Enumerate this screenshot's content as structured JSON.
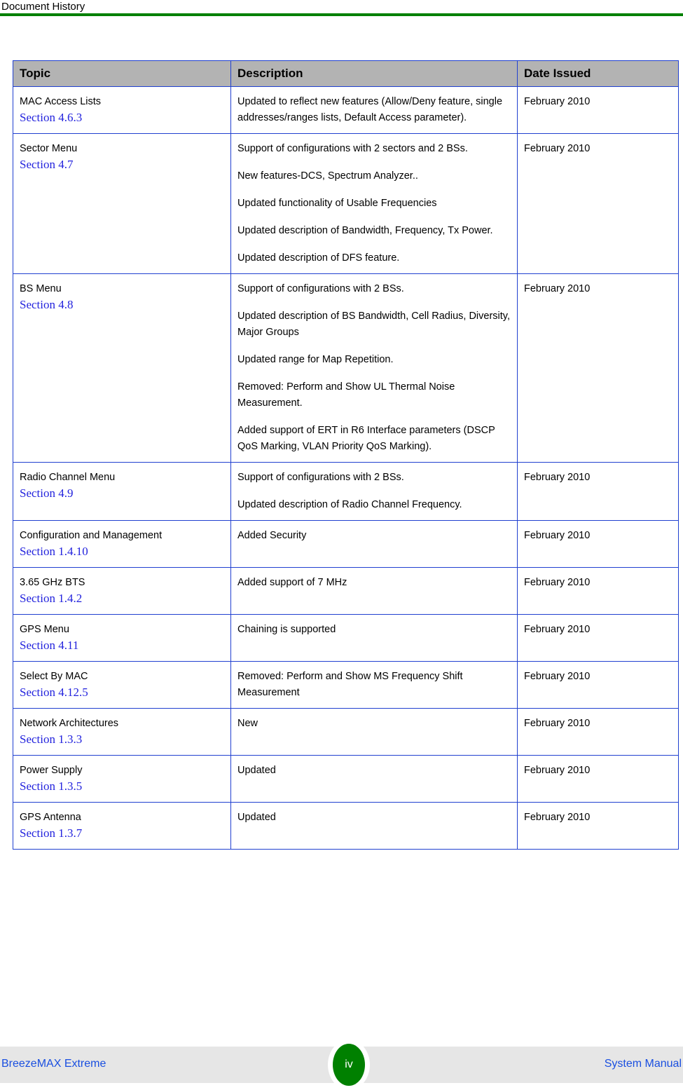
{
  "header": {
    "running_title": "Document History",
    "rule_color": "#008000"
  },
  "table": {
    "columns": [
      "Topic",
      "Description",
      "Date Issued"
    ],
    "header_bg": "#b3b3b3",
    "border_color": "#2040d0",
    "link_color": "#2222dd",
    "rows": [
      {
        "topic": "MAC Access Lists",
        "section": "Section 4.6.3",
        "description": [
          "Updated to reflect new features (Allow/Deny feature, single addresses/ranges lists, Default Access parameter)."
        ],
        "date": "February 2010"
      },
      {
        "topic": "Sector Menu",
        "section": "Section 4.7",
        "description": [
          "Support of configurations with 2 sectors and 2 BSs.",
          "New features-DCS, Spectrum Analyzer..",
          "Updated functionality of Usable Frequencies",
          "Updated description of Bandwidth, Frequency, Tx Power.",
          "Updated description of DFS feature."
        ],
        "date": "February 2010"
      },
      {
        "topic": "BS Menu",
        "section": "Section 4.8",
        "description": [
          "Support of configurations with 2 BSs.",
          "Updated description of BS Bandwidth, Cell Radius, Diversity, Major Groups",
          "Updated range for Map Repetition.",
          "Removed: Perform and Show UL Thermal Noise Measurement.",
          "Added support of ERT in R6 Interface parameters (DSCP QoS Marking, VLAN Priority QoS Marking)."
        ],
        "date": "February 2010"
      },
      {
        "topic": "Radio Channel Menu",
        "section": "Section 4.9",
        "description": [
          "Support of configurations with 2 BSs.",
          "Updated description of Radio Channel Frequency."
        ],
        "date": "February 2010"
      },
      {
        "topic": "Configuration and Management",
        "section": "Section 1.4.10",
        "description": [
          "Added Security"
        ],
        "date": "February 2010"
      },
      {
        "topic": "3.65 GHz BTS",
        "section": "Section 1.4.2",
        "description": [
          "Added support of 7 MHz"
        ],
        "date": "February 2010"
      },
      {
        "topic": "GPS Menu",
        "section": "Section 4.11",
        "description": [
          "Chaining is supported"
        ],
        "date": "February 2010"
      },
      {
        "topic": "Select By MAC",
        "section": "Section 4.12.5",
        "description": [
          "Removed: Perform and Show MS Frequency Shift Measurement"
        ],
        "date": "February 2010"
      },
      {
        "topic": "Network Architectures",
        "section": "Section 1.3.3",
        "description": [
          "New"
        ],
        "date": "February 2010"
      },
      {
        "topic": "Power Supply",
        "section": "Section 1.3.5",
        "description": [
          "Updated"
        ],
        "date": "February 2010"
      },
      {
        "topic": "GPS Antenna",
        "section": "Section 1.3.7",
        "description": [
          "Updated"
        ],
        "date": "February 2010"
      }
    ]
  },
  "footer": {
    "left": "BreezeMAX Extreme",
    "page_number": "iv",
    "right": "System Manual",
    "band_bg": "#e6e6e6",
    "badge_color": "#008000",
    "text_color": "#1a4fe0"
  }
}
